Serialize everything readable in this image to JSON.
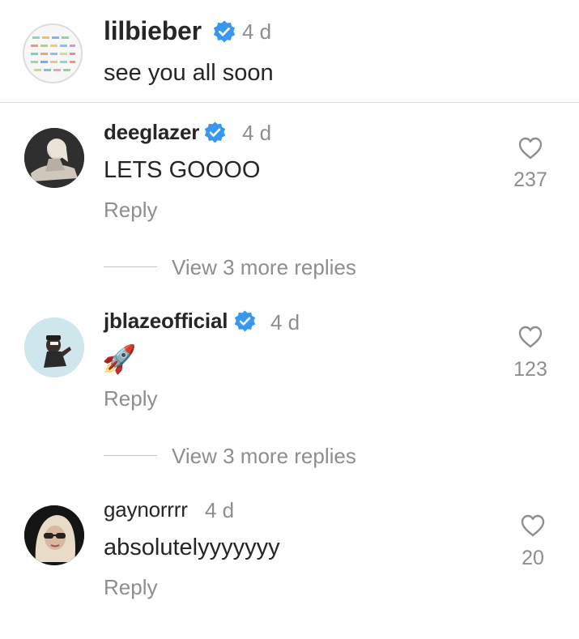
{
  "caption": {
    "username": "lilbieber",
    "time": "4 d",
    "text": "see you all soon"
  },
  "comments": [
    {
      "username": "deeglazer",
      "verified": true,
      "time": "4 d",
      "text": "LETS GOOOO",
      "reply_label": "Reply",
      "likes": "237",
      "view_replies": "View 3 more replies"
    },
    {
      "username": "jblazeofficial",
      "verified": true,
      "time": "4 d",
      "text": "🚀",
      "reply_label": "Reply",
      "likes": "123",
      "view_replies": "View 3 more replies"
    },
    {
      "username": "gaynorrrr",
      "verified": false,
      "time": "4 d",
      "text": "absolutelyyyyyyy",
      "reply_label": "Reply",
      "likes": "20"
    }
  ],
  "colors": {
    "verified_badge": "#3897f0",
    "secondary_text": "#8e8e8e",
    "primary_text": "#262626"
  }
}
